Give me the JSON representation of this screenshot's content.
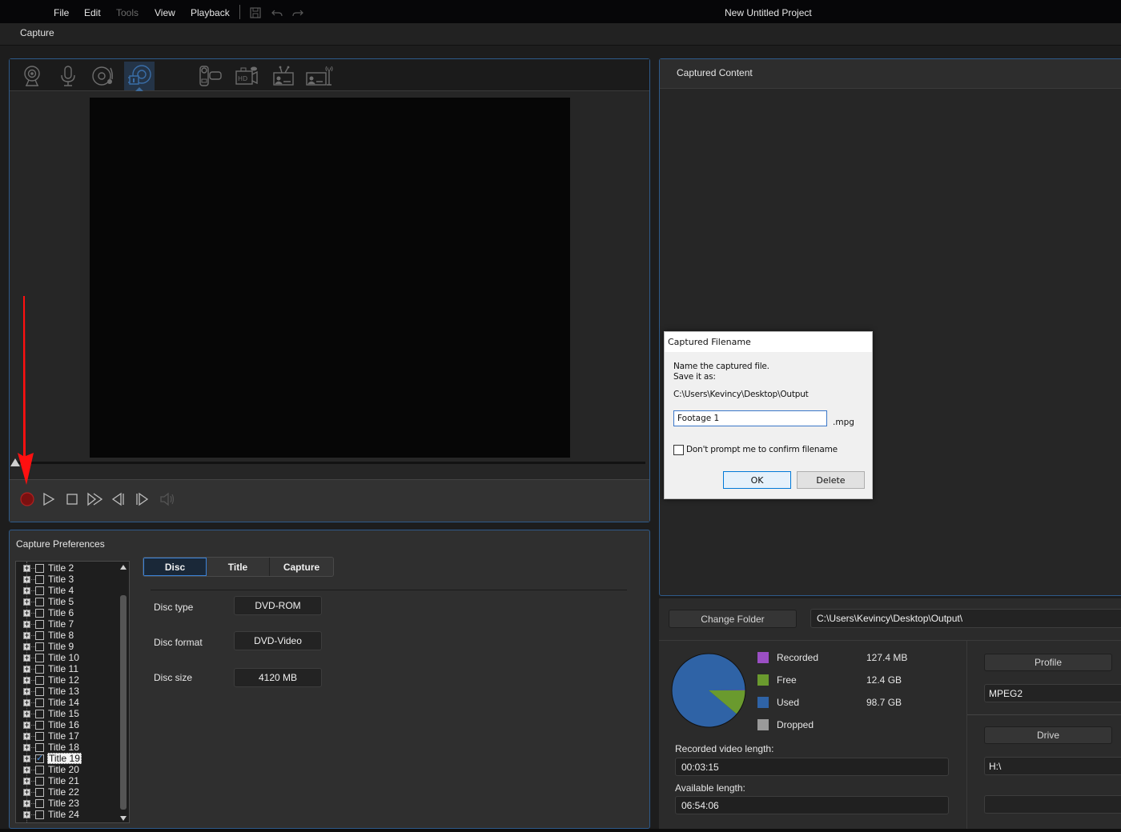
{
  "menubar": {
    "items": [
      {
        "label": "File",
        "enabled": true
      },
      {
        "label": "Edit",
        "enabled": true
      },
      {
        "label": "Tools",
        "enabled": false
      },
      {
        "label": "View",
        "enabled": true
      },
      {
        "label": "Playback",
        "enabled": true
      }
    ],
    "toolbar_icons": [
      "save-icon",
      "undo-icon",
      "redo-icon"
    ],
    "app_title": "New Untitled Project"
  },
  "modebar": {
    "label": "Capture"
  },
  "capture_sources": [
    {
      "name": "webcam",
      "icon": "webcam-icon",
      "active": false
    },
    {
      "name": "microphone",
      "icon": "microphone-icon",
      "active": false
    },
    {
      "name": "cd-audio",
      "icon": "cd-audio-icon",
      "active": false
    },
    {
      "name": "dvd",
      "icon": "dvd-capture-icon",
      "active": true
    },
    {
      "name": "dv-camcorder",
      "icon": "dv-camcorder-icon",
      "active": false
    },
    {
      "name": "hdv-camcorder",
      "icon": "hdv-camcorder-icon",
      "active": false
    },
    {
      "name": "tv",
      "icon": "tv-icon",
      "active": false
    },
    {
      "name": "digital-tv",
      "icon": "digital-tv-icon",
      "active": false
    }
  ],
  "transport": {
    "buttons": [
      "record",
      "play",
      "stop",
      "fast-forward",
      "previous-frame",
      "next-frame",
      "volume"
    ],
    "record_color": "#7a1010"
  },
  "capture_preferences": {
    "title": "Capture Preferences",
    "titles": [
      {
        "label": "Title 2",
        "checked": false
      },
      {
        "label": "Title 3",
        "checked": false
      },
      {
        "label": "Title 4",
        "checked": false
      },
      {
        "label": "Title 5",
        "checked": false
      },
      {
        "label": "Title 6",
        "checked": false
      },
      {
        "label": "Title 7",
        "checked": false
      },
      {
        "label": "Title 8",
        "checked": false
      },
      {
        "label": "Title 9",
        "checked": false
      },
      {
        "label": "Title 10",
        "checked": false
      },
      {
        "label": "Title 11",
        "checked": false
      },
      {
        "label": "Title 12",
        "checked": false
      },
      {
        "label": "Title 13",
        "checked": false
      },
      {
        "label": "Title 14",
        "checked": false
      },
      {
        "label": "Title 15",
        "checked": false
      },
      {
        "label": "Title 16",
        "checked": false
      },
      {
        "label": "Title 17",
        "checked": false
      },
      {
        "label": "Title 18",
        "checked": false
      },
      {
        "label": "Title 19",
        "checked": true,
        "selected": true
      },
      {
        "label": "Title 20",
        "checked": false
      },
      {
        "label": "Title 21",
        "checked": false
      },
      {
        "label": "Title 22",
        "checked": false
      },
      {
        "label": "Title 23",
        "checked": false
      },
      {
        "label": "Title 24",
        "checked": false
      }
    ],
    "tabs": [
      {
        "label": "Disc",
        "active": true
      },
      {
        "label": "Title",
        "active": false
      },
      {
        "label": "Capture",
        "active": false
      }
    ],
    "fields": [
      {
        "label": "Disc type",
        "value": "DVD-ROM"
      },
      {
        "label": "Disc format",
        "value": "DVD-Video"
      },
      {
        "label": "Disc size",
        "value": "4120 MB"
      }
    ]
  },
  "captured_content": {
    "title": "Captured Content",
    "change_folder_label": "Change Folder",
    "folder_path": "C:\\Users\\Kevincy\\Desktop\\Output\\"
  },
  "disk_usage": {
    "legend": [
      {
        "name": "Recorded",
        "value": "127.4  MB",
        "color": "#9b4fc4"
      },
      {
        "name": "Free",
        "value": "12.4  GB",
        "color": "#6a9a2e"
      },
      {
        "name": "Used",
        "value": "98.7  GB",
        "color": "#2f63a6"
      },
      {
        "name": "Dropped",
        "value": "",
        "color": "#9a9a9a"
      }
    ],
    "pie": {
      "recorded_gb": 0.1274,
      "free_gb": 12.4,
      "used_gb": 98.7
    },
    "recorded_length_label": "Recorded video length:",
    "recorded_length": "00:03:15",
    "available_length_label": "Available length:",
    "available_length": "06:54:06"
  },
  "output_settings": {
    "profile_label": "Profile",
    "profile_value": "MPEG2",
    "drive_label": "Drive",
    "drive_value": "H:\\",
    "extra_value": ""
  },
  "dialog": {
    "title": "Captured Filename",
    "line1": "Name the captured file.",
    "line2": "Save it as:",
    "path": "C:\\Users\\Kevincy\\Desktop\\Output",
    "filename": "Footage 1",
    "extension": ".mpg",
    "dont_prompt_label": "Don't prompt me to confirm filename",
    "dont_prompt_checked": false,
    "ok_label": "OK",
    "delete_label": "Delete"
  }
}
